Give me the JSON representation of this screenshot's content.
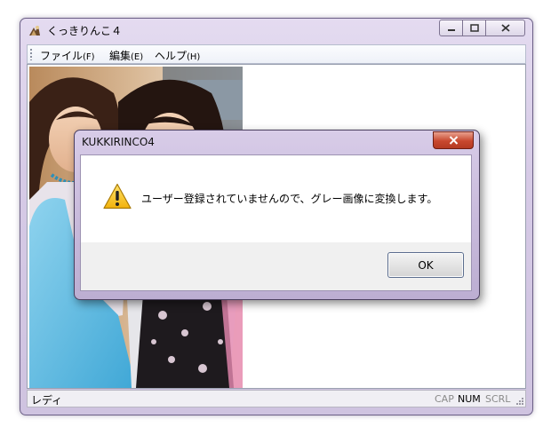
{
  "window": {
    "title": "くっきりんこ４",
    "controls": {
      "minimize": "minimize",
      "maximize": "maximize",
      "close": "close"
    }
  },
  "menu": {
    "items": [
      {
        "label": "ファイル",
        "accel": "(F)"
      },
      {
        "label": "編集",
        "accel": "(E)"
      },
      {
        "label": "ヘルプ",
        "accel": "(H)"
      }
    ]
  },
  "status": {
    "text": "レディ",
    "indicators": [
      {
        "label": "CAP",
        "active": false
      },
      {
        "label": "NUM",
        "active": true
      },
      {
        "label": "SCRL",
        "active": false
      }
    ]
  },
  "dialog": {
    "title": "KUKKIRINCO4",
    "message": "ユーザー登録されていませんので、グレー画像に変換します。",
    "icon": "warning-icon",
    "ok_label": "OK"
  },
  "colors": {
    "title_gradient": "#d6cae6",
    "dialog_close_red": "#c8482e",
    "warning_yellow": "#f2c21a"
  }
}
